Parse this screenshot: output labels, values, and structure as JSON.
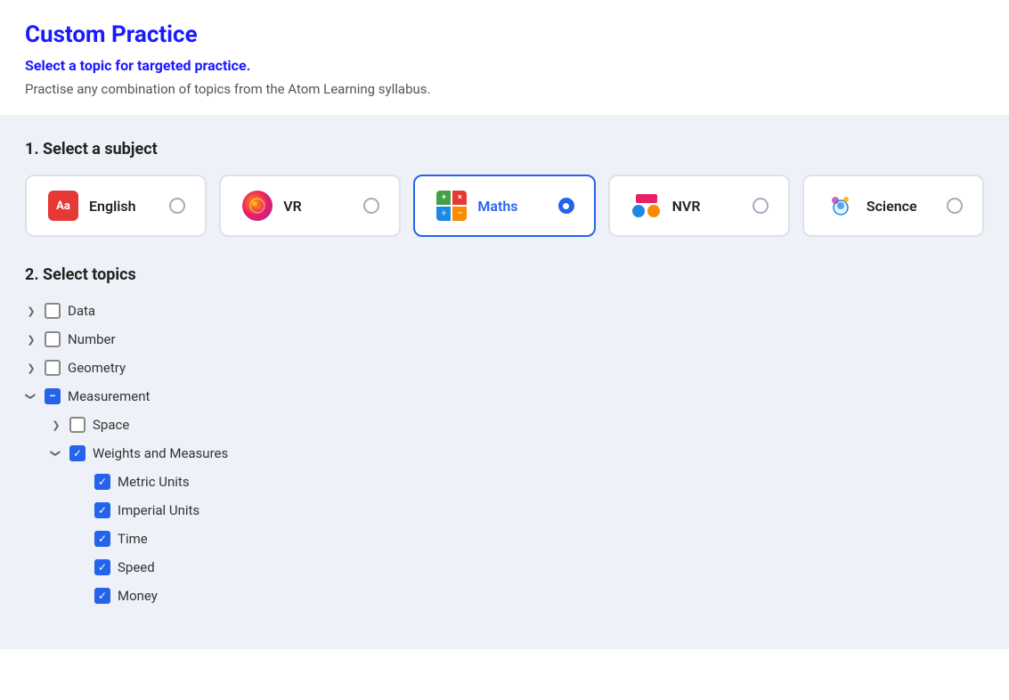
{
  "page": {
    "title": "Custom Practice",
    "subtitle": "Select a topic for targeted practice.",
    "description": "Practise any combination of topics from the Atom Learning syllabus."
  },
  "step1": {
    "label": "1. Select a subject"
  },
  "subjects": [
    {
      "id": "english",
      "name": "English",
      "selected": false,
      "icon": "english-icon"
    },
    {
      "id": "vr",
      "name": "VR",
      "selected": false,
      "icon": "vr-icon"
    },
    {
      "id": "maths",
      "name": "Maths",
      "selected": true,
      "icon": "maths-icon"
    },
    {
      "id": "nvr",
      "name": "NVR",
      "selected": false,
      "icon": "nvr-icon"
    },
    {
      "id": "science",
      "name": "Science",
      "selected": false,
      "icon": "science-icon"
    }
  ],
  "step2": {
    "label": "2. Select topics"
  },
  "topics": [
    {
      "id": "data",
      "label": "Data",
      "level": 1,
      "expanded": false,
      "checked": false,
      "indeterminate": false
    },
    {
      "id": "number",
      "label": "Number",
      "level": 1,
      "expanded": false,
      "checked": false,
      "indeterminate": false
    },
    {
      "id": "geometry",
      "label": "Geometry",
      "level": 1,
      "expanded": false,
      "checked": false,
      "indeterminate": false
    },
    {
      "id": "measurement",
      "label": "Measurement",
      "level": 1,
      "expanded": true,
      "checked": false,
      "indeterminate": true
    },
    {
      "id": "space",
      "label": "Space",
      "level": 2,
      "expanded": false,
      "checked": false,
      "indeterminate": false
    },
    {
      "id": "weights-and-measures",
      "label": "Weights and Measures",
      "level": 2,
      "expanded": true,
      "checked": true,
      "indeterminate": false
    },
    {
      "id": "metric-units",
      "label": "Metric Units",
      "level": 3,
      "expanded": false,
      "checked": true,
      "indeterminate": false
    },
    {
      "id": "imperial-units",
      "label": "Imperial Units",
      "level": 3,
      "expanded": false,
      "checked": true,
      "indeterminate": false
    },
    {
      "id": "time",
      "label": "Time",
      "level": 3,
      "expanded": false,
      "checked": true,
      "indeterminate": false
    },
    {
      "id": "speed",
      "label": "Speed",
      "level": 3,
      "expanded": false,
      "checked": true,
      "indeterminate": false
    },
    {
      "id": "money",
      "label": "Money",
      "level": 3,
      "expanded": false,
      "checked": true,
      "indeterminate": false
    }
  ]
}
